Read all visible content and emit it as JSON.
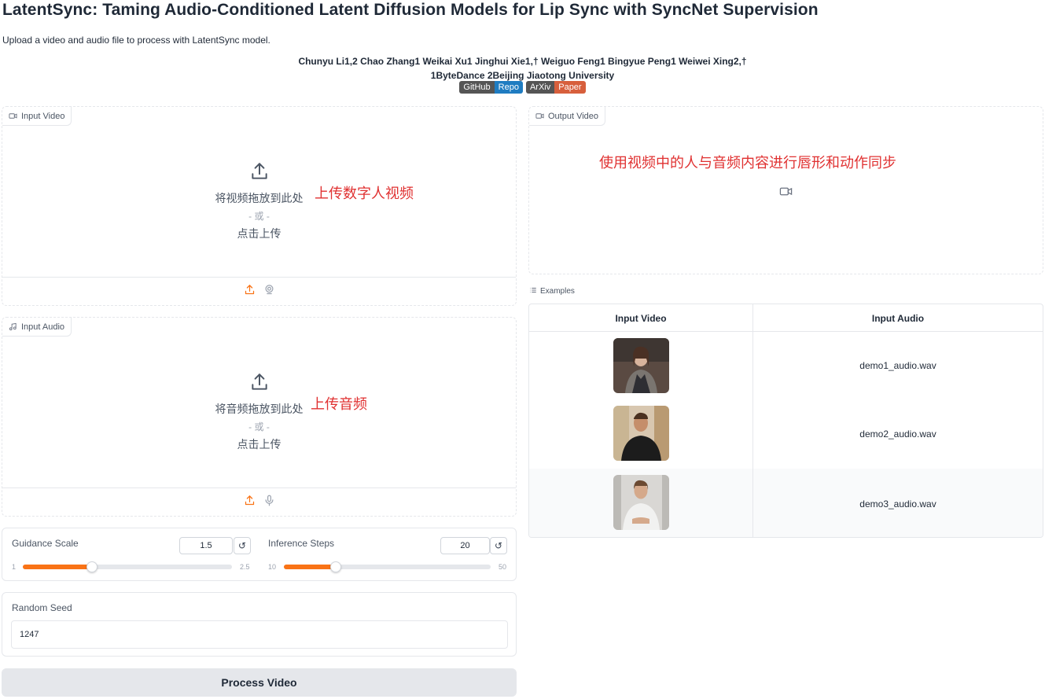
{
  "header": {
    "title": "LatentSync: Taming Audio-Conditioned Latent Diffusion Models for Lip Sync with SyncNet Supervision",
    "subtitle": "Upload a video and audio file to process with LatentSync model.",
    "authors": "Chunyu Li1,2 Chao Zhang1 Weikai Xu1 Jinghui Xie1,† Weiguo Feng1 Bingyue Peng1 Weiwei Xing2,†",
    "affiliations": "1ByteDance 2Beijing Jiaotong University",
    "badges": [
      {
        "left": "GitHub",
        "right": "Repo",
        "color": "#1f7cc1"
      },
      {
        "left": "ArXiv",
        "right": "Paper",
        "color": "#d75f3c"
      }
    ]
  },
  "input_video": {
    "label": "Input Video",
    "drop_text": "将视频拖放到此处",
    "or_text": "- 或 -",
    "click_text": "点击上传",
    "annotation": "上传数字人视频"
  },
  "input_audio": {
    "label": "Input Audio",
    "drop_text": "将音频拖放到此处",
    "or_text": "- 或 -",
    "click_text": "点击上传",
    "annotation": "上传音频"
  },
  "sliders": {
    "guidance": {
      "label": "Guidance Scale",
      "value": "1.5",
      "min": "1",
      "max": "2.5",
      "fraction": 0.33
    },
    "steps": {
      "label": "Inference Steps",
      "value": "20",
      "min": "10",
      "max": "50",
      "fraction": 0.25
    }
  },
  "seed": {
    "label": "Random Seed",
    "value": "1247"
  },
  "process_button": "Process Video",
  "output_video": {
    "label": "Output Video",
    "annotation": "使用视频中的人与音频内容进行唇形和动作同步"
  },
  "examples": {
    "label": "Examples",
    "columns": [
      "Input Video",
      "Input Audio"
    ],
    "rows": [
      {
        "audio": "demo1_audio.wav"
      },
      {
        "audio": "demo2_audio.wav"
      },
      {
        "audio": "demo3_audio.wav"
      }
    ]
  },
  "colors": {
    "accent": "#f97316",
    "annotation": "#e03131"
  }
}
